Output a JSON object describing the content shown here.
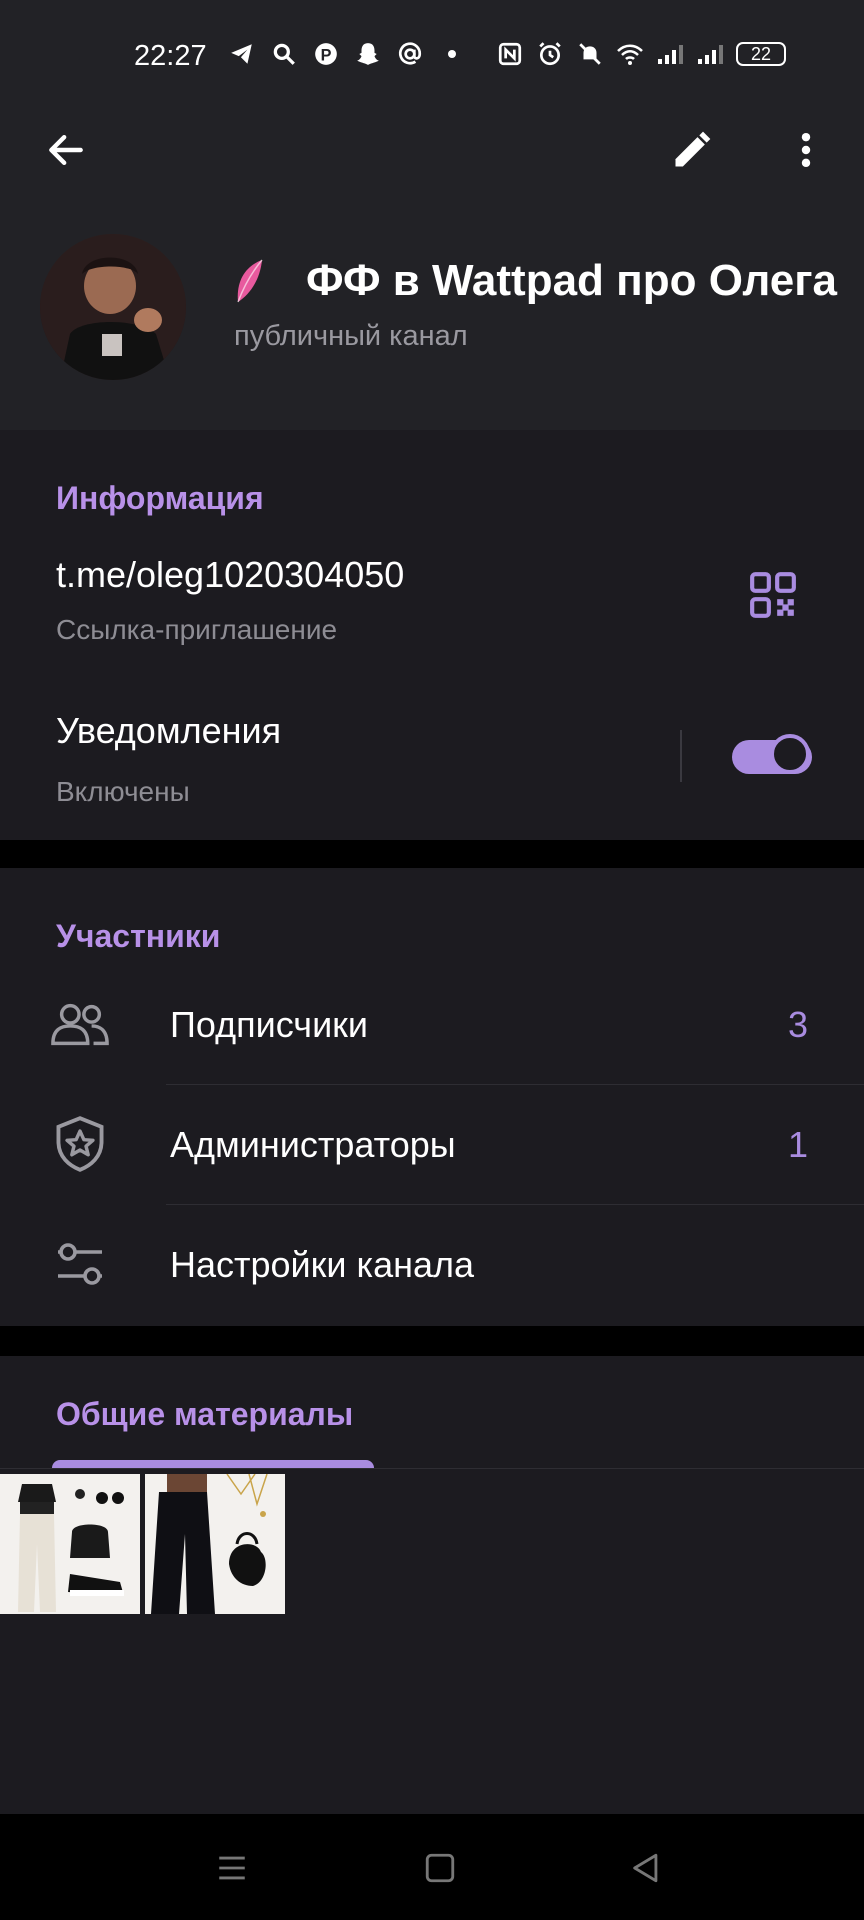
{
  "status_bar": {
    "time": "22:27",
    "battery": "22",
    "left_icons": [
      "telegram-icon",
      "search-icon",
      "pinterest-icon",
      "snapchat-icon",
      "at-sign-icon",
      "dot-icon"
    ],
    "right_icons": [
      "nfc-icon",
      "alarm-icon",
      "mute-icon",
      "wifi-icon",
      "signal-1-icon",
      "signal-2-icon"
    ]
  },
  "header": {
    "back_icon": "arrow-left-icon",
    "edit_icon": "pencil-icon",
    "more_icon": "more-vertical-icon",
    "title": "ФФ в Wattpad про Олега",
    "subtitle": "публичный канал"
  },
  "info": {
    "section_title": "Информация",
    "link": "t.me/oleg1020304050",
    "link_caption": "Ссылка-приглашение",
    "notifications_label": "Уведомления",
    "notifications_state": "Включены",
    "notifications_on": true
  },
  "members": {
    "section_title": "Участники",
    "items": [
      {
        "label": "Подписчики",
        "count": "3",
        "icon": "users-icon"
      },
      {
        "label": "Администраторы",
        "count": "1",
        "icon": "shield-star-icon"
      },
      {
        "label": "Настройки канала",
        "count": "",
        "icon": "sliders-icon"
      }
    ]
  },
  "media": {
    "tab_label": "Общие материалы"
  },
  "colors": {
    "accent": "#a98ce0",
    "accent_text": "#b891e8",
    "background": "#1c1b20",
    "header_bg": "#222226"
  }
}
